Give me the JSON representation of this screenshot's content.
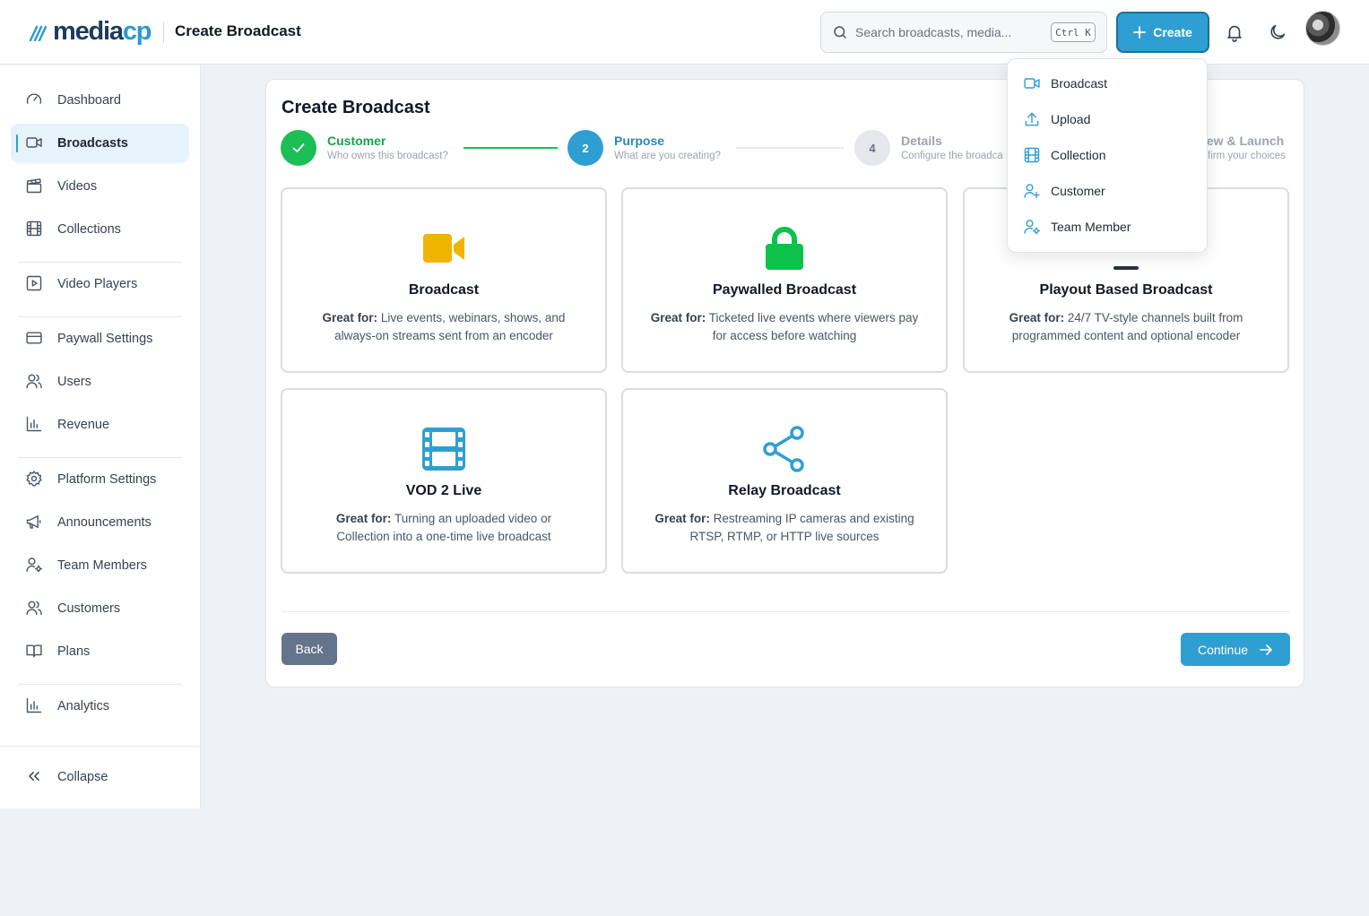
{
  "header": {
    "logo_main": "media",
    "logo_accent": "cp",
    "page_title": "Create Broadcast",
    "search_placeholder": "Search broadcasts, media...",
    "search_shortcut": "Ctrl K",
    "create_label": "Create"
  },
  "sidebar": {
    "items": [
      {
        "label": "Dashboard",
        "icon": "gauge-icon"
      },
      {
        "label": "Broadcasts",
        "icon": "video-camera-icon",
        "active": true
      },
      {
        "label": "Videos",
        "icon": "clapperboard-icon"
      },
      {
        "label": "Collections",
        "icon": "film-icon"
      },
      {
        "label": "Video Players",
        "icon": "play-square-icon"
      },
      {
        "label": "Paywall Settings",
        "icon": "credit-card-icon"
      },
      {
        "label": "Users",
        "icon": "users-icon"
      },
      {
        "label": "Revenue",
        "icon": "bar-chart-icon"
      },
      {
        "label": "Platform Settings",
        "icon": "gear-icon"
      },
      {
        "label": "Announcements",
        "icon": "megaphone-icon"
      },
      {
        "label": "Team Members",
        "icon": "user-gear-icon"
      },
      {
        "label": "Customers",
        "icon": "users-icon"
      },
      {
        "label": "Plans",
        "icon": "book-icon"
      },
      {
        "label": "Analytics",
        "icon": "bar-chart-icon"
      }
    ],
    "collapse_label": "Collapse"
  },
  "wizard": {
    "title": "Create Broadcast",
    "steps": [
      {
        "number": "",
        "title": "Customer",
        "subtitle": "Who owns this broadcast?",
        "state": "done"
      },
      {
        "number": "2",
        "title": "Purpose",
        "subtitle": "What are you creating?",
        "state": "current"
      },
      {
        "number": "4",
        "title": "Details",
        "subtitle": "Configure the broadca",
        "state": "upcoming"
      },
      {
        "number": "",
        "title": "iew & Launch",
        "subtitle": "firm your choices",
        "state": "upcoming"
      }
    ],
    "options": [
      {
        "title": "Broadcast",
        "great_for_label": "Great for:",
        "desc": " Live events, webinars, shows, and always-on streams sent from an encoder",
        "icon": "video-camera-icon",
        "color": "#f0b400"
      },
      {
        "title": "Paywalled Broadcast",
        "great_for_label": "Great for:",
        "desc": " Ticketed live events where viewers pay for access before watching",
        "icon": "lock-icon",
        "color": "#0dc24a"
      },
      {
        "title": "Playout Based Broadcast",
        "great_for_label": "Great for:",
        "desc": " 24/7 TV-style channels built from programmed content and optional encoder",
        "icon": "tv-icon",
        "color": "#2a2f45"
      },
      {
        "title": "VOD 2 Live",
        "great_for_label": "Great for:",
        "desc": " Turning an uploaded video or Collection into a one-time live broadcast",
        "icon": "film-icon",
        "color": "#2f9fd3"
      },
      {
        "title": "Relay Broadcast",
        "great_for_label": "Great for:",
        "desc": " Restreaming IP cameras and existing RTSP, RTMP, or HTTP live sources",
        "icon": "share-icon",
        "color": "#2f9fd3"
      }
    ],
    "back_label": "Back",
    "continue_label": "Continue"
  },
  "create_menu": {
    "items": [
      {
        "label": "Broadcast",
        "icon": "video-camera-icon"
      },
      {
        "label": "Upload",
        "icon": "upload-icon"
      },
      {
        "label": "Collection",
        "icon": "film-icon"
      },
      {
        "label": "Customer",
        "icon": "user-plus-icon"
      },
      {
        "label": "Team Member",
        "icon": "user-gear-icon"
      }
    ]
  },
  "colors": {
    "accent": "#2f9fd3",
    "success": "#0dc24a",
    "step_done": "#1bbf55"
  }
}
